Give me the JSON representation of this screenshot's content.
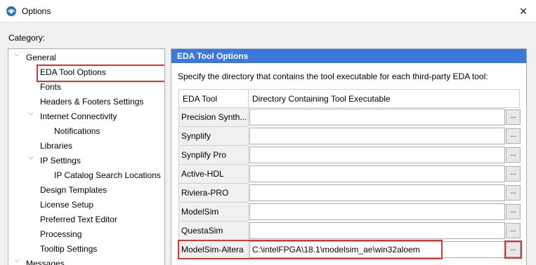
{
  "window": {
    "title": "Options",
    "close_glyph": "✕"
  },
  "category_label": "Category:",
  "tree": {
    "items": [
      {
        "label": "General",
        "expander": "⌵"
      },
      {
        "label": "EDA Tool Options",
        "expander": ""
      },
      {
        "label": "Fonts",
        "expander": ""
      },
      {
        "label": "Headers & Footers Settings",
        "expander": ""
      },
      {
        "label": "Internet Connectivity",
        "expander": "⌵"
      },
      {
        "label": "Notifications",
        "expander": ""
      },
      {
        "label": "Libraries",
        "expander": ""
      },
      {
        "label": "IP Settings",
        "expander": "⌵"
      },
      {
        "label": "IP Catalog Search Locations",
        "expander": ""
      },
      {
        "label": "Design Templates",
        "expander": ""
      },
      {
        "label": "License Setup",
        "expander": ""
      },
      {
        "label": "Preferred Text Editor",
        "expander": ""
      },
      {
        "label": "Processing",
        "expander": ""
      },
      {
        "label": "Tooltip Settings",
        "expander": ""
      },
      {
        "label": "Messages",
        "expander": "⌵"
      }
    ],
    "selected": "EDA Tool Options"
  },
  "panel": {
    "header": "EDA Tool Options",
    "description": "Specify the directory that contains the tool executable for each third-party EDA tool:",
    "columns": [
      "EDA Tool",
      "Directory Containing Tool Executable"
    ],
    "browse_label": "...",
    "rows": [
      {
        "tool": "Precision Synth...",
        "path": ""
      },
      {
        "tool": "Synplify",
        "path": ""
      },
      {
        "tool": "Synplify Pro",
        "path": ""
      },
      {
        "tool": "Active-HDL",
        "path": ""
      },
      {
        "tool": "Riviera-PRO",
        "path": ""
      },
      {
        "tool": "ModelSim",
        "path": ""
      },
      {
        "tool": "QuestaSim",
        "path": ""
      },
      {
        "tool": "ModelSim-Altera",
        "path": "C:\\intelFPGA\\18.1\\modelsim_ae\\win32aloem"
      }
    ]
  },
  "colors": {
    "header_blue": "#3c78d8",
    "highlight_red": "#e0352f"
  }
}
